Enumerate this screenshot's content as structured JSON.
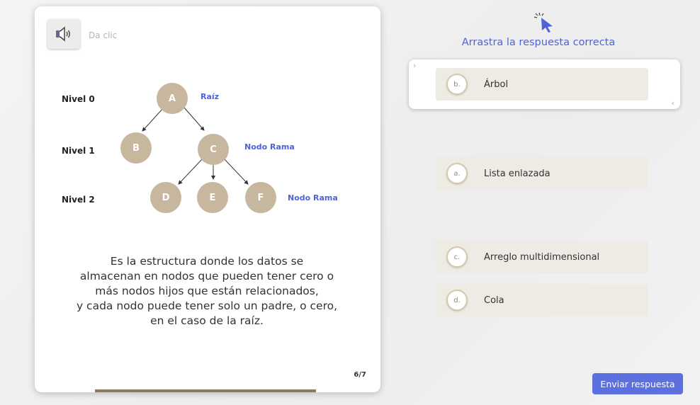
{
  "audio": {
    "label": "Da clic",
    "icon": "speaker-icon"
  },
  "tree": {
    "levels": [
      "Nivel 0",
      "Nivel 1",
      "Nivel 2"
    ],
    "nodes": {
      "a": "A",
      "b": "B",
      "c": "C",
      "d": "D",
      "e": "E",
      "f": "F"
    },
    "tags": {
      "root": "Raíz",
      "branch_c": "Nodo Rama",
      "branch_level2": "Nodo Rama"
    }
  },
  "question": {
    "lines": [
      "Es la estructura donde los datos se",
      "almacenan en nodos que pueden tener cero o",
      "más nodos hijos que están relacionados,",
      "y cada nodo puede tener solo un padre, o cero,",
      "en el caso de la raíz."
    ],
    "page": "6/7",
    "progress": 0.857
  },
  "instruction": "Arrastra la respuesta correcta",
  "dropzone": {
    "badge": "b.",
    "text": "Árbol",
    "left_arrow": "›",
    "right_arrow": "‹"
  },
  "options": [
    {
      "badge": "a.",
      "text": "Lista enlazada"
    },
    {
      "badge": "c.",
      "text": "Arreglo multidimensional"
    },
    {
      "badge": "d.",
      "text": "Cola"
    }
  ],
  "submit_label": "Enviar respuesta",
  "colors": {
    "accent": "#5d70e0",
    "node": "#c8b79f",
    "progress": "#8c7a5b",
    "tag": "#4f63d8"
  }
}
